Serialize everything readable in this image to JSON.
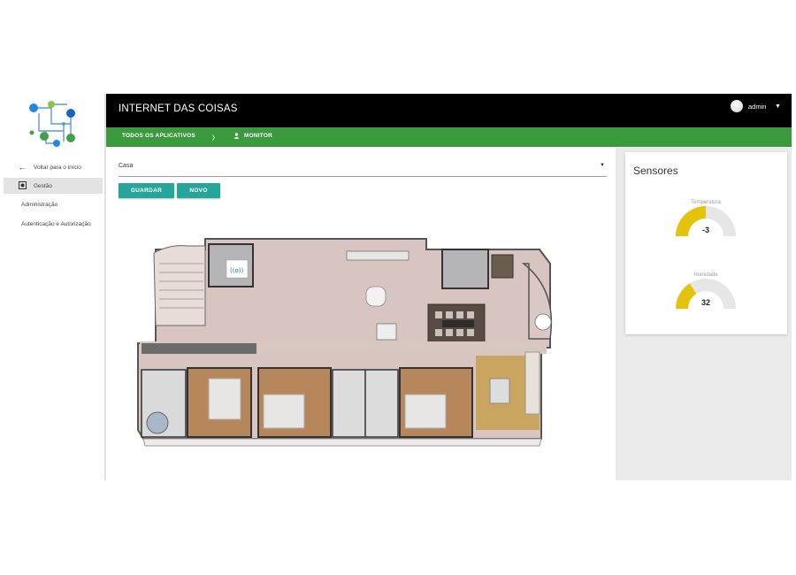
{
  "sidebar": {
    "items": [
      {
        "label": "Voltar para o início",
        "icon": "arrow-left-icon"
      },
      {
        "label": "Gestão",
        "icon": "gear-box-icon"
      },
      {
        "label": "Administração"
      },
      {
        "label": "Autenticação e Autorização"
      }
    ]
  },
  "header": {
    "title": "INTERNET DAS COISAS",
    "user": "admin"
  },
  "navbar": {
    "apps_label": "TODOS OS APLICATIVOS",
    "separator": "〉",
    "current": "MONITOR"
  },
  "main": {
    "select_value": "Casa",
    "save_label": "GUARDAR",
    "new_label": "NOVO"
  },
  "sensors": {
    "title": "Sensores",
    "gauges": [
      {
        "label": "Temperatura",
        "value": "-3",
        "fill": 0.5
      },
      {
        "label": "Humidade",
        "value": "32",
        "fill": 0.32
      }
    ]
  },
  "colors": {
    "header_bg": "#000000",
    "nav_bg": "#3c9a3e",
    "button_bg": "#26a69a",
    "gauge_fill": "#e4c30c",
    "gauge_track": "#e6e6e6"
  }
}
